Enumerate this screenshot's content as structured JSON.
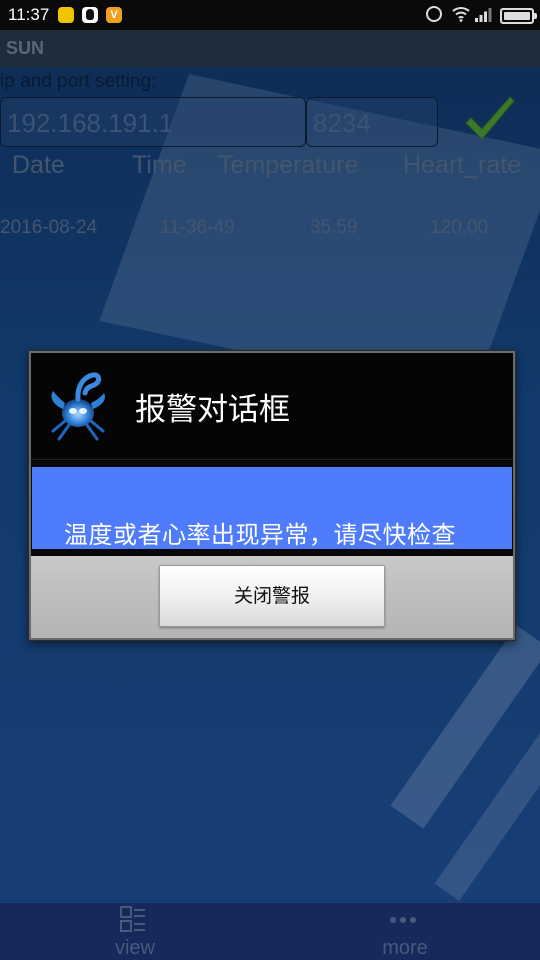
{
  "status_bar": {
    "time": "11:37",
    "notification_icons": [
      "yellow-app-icon",
      "qq-icon",
      "v-app-icon"
    ],
    "v_label": "V",
    "system_icons": [
      "alarm-icon",
      "wifi-icon",
      "signal-icon",
      "battery-icon"
    ]
  },
  "app": {
    "title": "SUN"
  },
  "settings": {
    "label": "ip and port setting:",
    "ip_value": "192.168.191.1",
    "port_value": "8234",
    "confirm_icon": "check-icon",
    "confirm_color": "#3c8c2c"
  },
  "table": {
    "headers": [
      "Date",
      "Time",
      "Temperature",
      "Heart_rate"
    ],
    "rows": [
      [
        "2016-08-24",
        "11-36-49",
        "35.59",
        "120.00"
      ]
    ]
  },
  "dialog": {
    "icon": "scorpion-app-icon",
    "title": "报警对话框",
    "message": "温度或者心率出现异常，请尽快检查",
    "message_bg": "#4f7bfd",
    "button_label": "关闭警报"
  },
  "bottom_nav": {
    "items": [
      {
        "label": "view",
        "icon": "view-icon"
      },
      {
        "label": "more",
        "icon": "more-icon"
      }
    ]
  }
}
